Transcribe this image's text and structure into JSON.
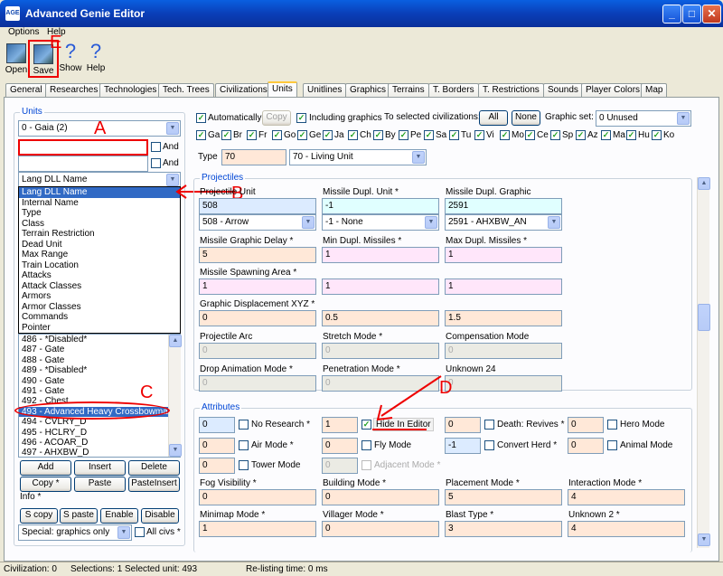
{
  "window": {
    "title": "Advanced Genie Editor",
    "icon_text": "AGE",
    "min": "_",
    "max": "□",
    "close": "✕"
  },
  "menu": [
    "Options",
    "Help"
  ],
  "toolbar": {
    "open": "Open",
    "save": "Save",
    "show": "Show",
    "help": "Help",
    "help_q": "?",
    "show_q": "?"
  },
  "tabs": [
    "General",
    "Researches",
    "Technologies",
    "Tech. Trees",
    "Civilizations",
    "Units",
    "Unitlines",
    "Graphics",
    "Terrains",
    "T. Borders",
    "T. Restrictions",
    "Sounds",
    "Player Colors",
    "Map"
  ],
  "units_panel": {
    "label": "Units",
    "civ_select": "0 - Gaia (2)",
    "search_value": "",
    "exclude_value": "",
    "and1": "And",
    "and2": "And",
    "list_by": "Lang DLL Name",
    "dropdown_options": [
      "Lang DLL Name",
      "Internal Name",
      "Type",
      "Class",
      "Terrain Restriction",
      "Dead Unit",
      "Max Range",
      "Train Location",
      "Attacks",
      "Attack Classes",
      "Armors",
      "Armor Classes",
      "Commands",
      "Pointer"
    ],
    "list_items": [
      "486 - *Disabled*",
      "487 - Gate",
      "488 - Gate",
      "489 - *Disabled*",
      "490 - Gate",
      "491 - Gate",
      "492 - Chest",
      "493 - Advanced Heavy Crossbowman",
      "494 - CVLRY_D",
      "495 - HCLRY_D",
      "496 - ACOAR_D",
      "497 - AHXBW_D"
    ],
    "buttons": [
      "Add",
      "Insert",
      "Delete",
      "Copy *",
      "Paste",
      "PasteInsert"
    ],
    "info": "Info *",
    "buttons2": [
      "S copy",
      "S paste",
      "Enable",
      "Disable"
    ],
    "special": "Special: graphics only",
    "all_civs": "All civs *"
  },
  "top_controls": {
    "automatically": "Automatically",
    "copy": "Copy",
    "including_graphics": "Including graphics",
    "to_selected": "To selected civilizations:",
    "all": "All",
    "none": "None",
    "graphic_set_label": "Graphic set:",
    "graphic_set": "0 Unused",
    "civs": [
      "Ga",
      "Br",
      "Fr",
      "Go",
      "Ge",
      "Ja",
      "Ch",
      "By",
      "Pe",
      "Sa",
      "Tu",
      "Vi",
      "Mo",
      "Ce",
      "Sp",
      "Az",
      "Ma",
      "Hu",
      "Ko"
    ]
  },
  "type": {
    "label": "Type",
    "value": "70",
    "select": "70 - Living Unit"
  },
  "projectiles": {
    "label": "Projectiles",
    "projectile_unit": {
      "label": "Projectile Unit",
      "value": "508",
      "select": "508 - Arrow"
    },
    "missile_dupl_unit": {
      "label": "Missile Dupl. Unit *",
      "value": "-1",
      "select": "-1 - None"
    },
    "missile_dupl_graphic": {
      "label": "Missile Dupl. Graphic",
      "value": "2591",
      "select": "2591 - AHXBW_AN"
    },
    "missile_graphic_delay": {
      "label": "Missile Graphic Delay *",
      "value": "5"
    },
    "min_dupl": {
      "label": "Min Dupl. Missiles *",
      "value": "1"
    },
    "max_dupl": {
      "label": "Max Dupl. Missiles *",
      "value": "1"
    },
    "spawning_area": {
      "label": "Missile Spawning Area *",
      "values": [
        "1",
        "1",
        "1"
      ]
    },
    "graphic_disp": {
      "label": "Graphic Displacement XYZ *",
      "values": [
        "0",
        "0.5",
        "1.5"
      ]
    },
    "projectile_arc": {
      "label": "Projectile Arc",
      "value": "0"
    },
    "stretch_mode": {
      "label": "Stretch Mode *",
      "value": "0"
    },
    "compensation_mode": {
      "label": "Compensation Mode",
      "value": "0"
    },
    "drop_anim": {
      "label": "Drop Animation Mode *",
      "value": "0"
    },
    "penetration": {
      "label": "Penetration Mode *",
      "value": "0"
    },
    "unknown24": {
      "label": "Unknown 24",
      "value": "0"
    }
  },
  "attributes": {
    "label": "Attributes",
    "no_research": {
      "value": "0",
      "label": "No Research *"
    },
    "hide_in_editor": {
      "value": "1",
      "label": "Hide In Editor"
    },
    "death_revives": {
      "value": "0",
      "label": "Death: Revives *"
    },
    "hero_mode": {
      "value": "0",
      "label": "Hero Mode"
    },
    "air_mode": {
      "value": "0",
      "label": "Air Mode *"
    },
    "fly_mode": {
      "value": "0",
      "label": "Fly Mode"
    },
    "convert_herd": {
      "value": "-1",
      "label": "Convert Herd *"
    },
    "animal_mode": {
      "value": "0",
      "label": "Animal Mode"
    },
    "tower_mode": {
      "value": "0",
      "label": "Tower Mode"
    },
    "adjacent_mode": {
      "value": "0",
      "label": "Adjacent Mode *"
    },
    "fog_visibility": {
      "label": "Fog Visibility *",
      "value": "0"
    },
    "building_mode": {
      "label": "Building Mode *",
      "value": "0"
    },
    "placement_mode": {
      "label": "Placement Mode *",
      "value": "5"
    },
    "interaction_mode": {
      "label": "Interaction Mode *",
      "value": "4"
    },
    "minimap_mode": {
      "label": "Minimap Mode *",
      "value": "1"
    },
    "villager_mode": {
      "label": "Villager Mode *",
      "value": "0"
    },
    "blast_type": {
      "label": "Blast Type *",
      "value": "3"
    },
    "unknown2": {
      "label": "Unknown 2 *",
      "value": "4"
    }
  },
  "annotations": {
    "a": "A",
    "b": "B",
    "c": "C",
    "d": "D",
    "e": "E"
  },
  "status": {
    "civ": "Civilization: 0",
    "selections": "Selections: 1",
    "selected": "Selected unit: 493",
    "relisting": "Re-listing time: 0 ms"
  }
}
